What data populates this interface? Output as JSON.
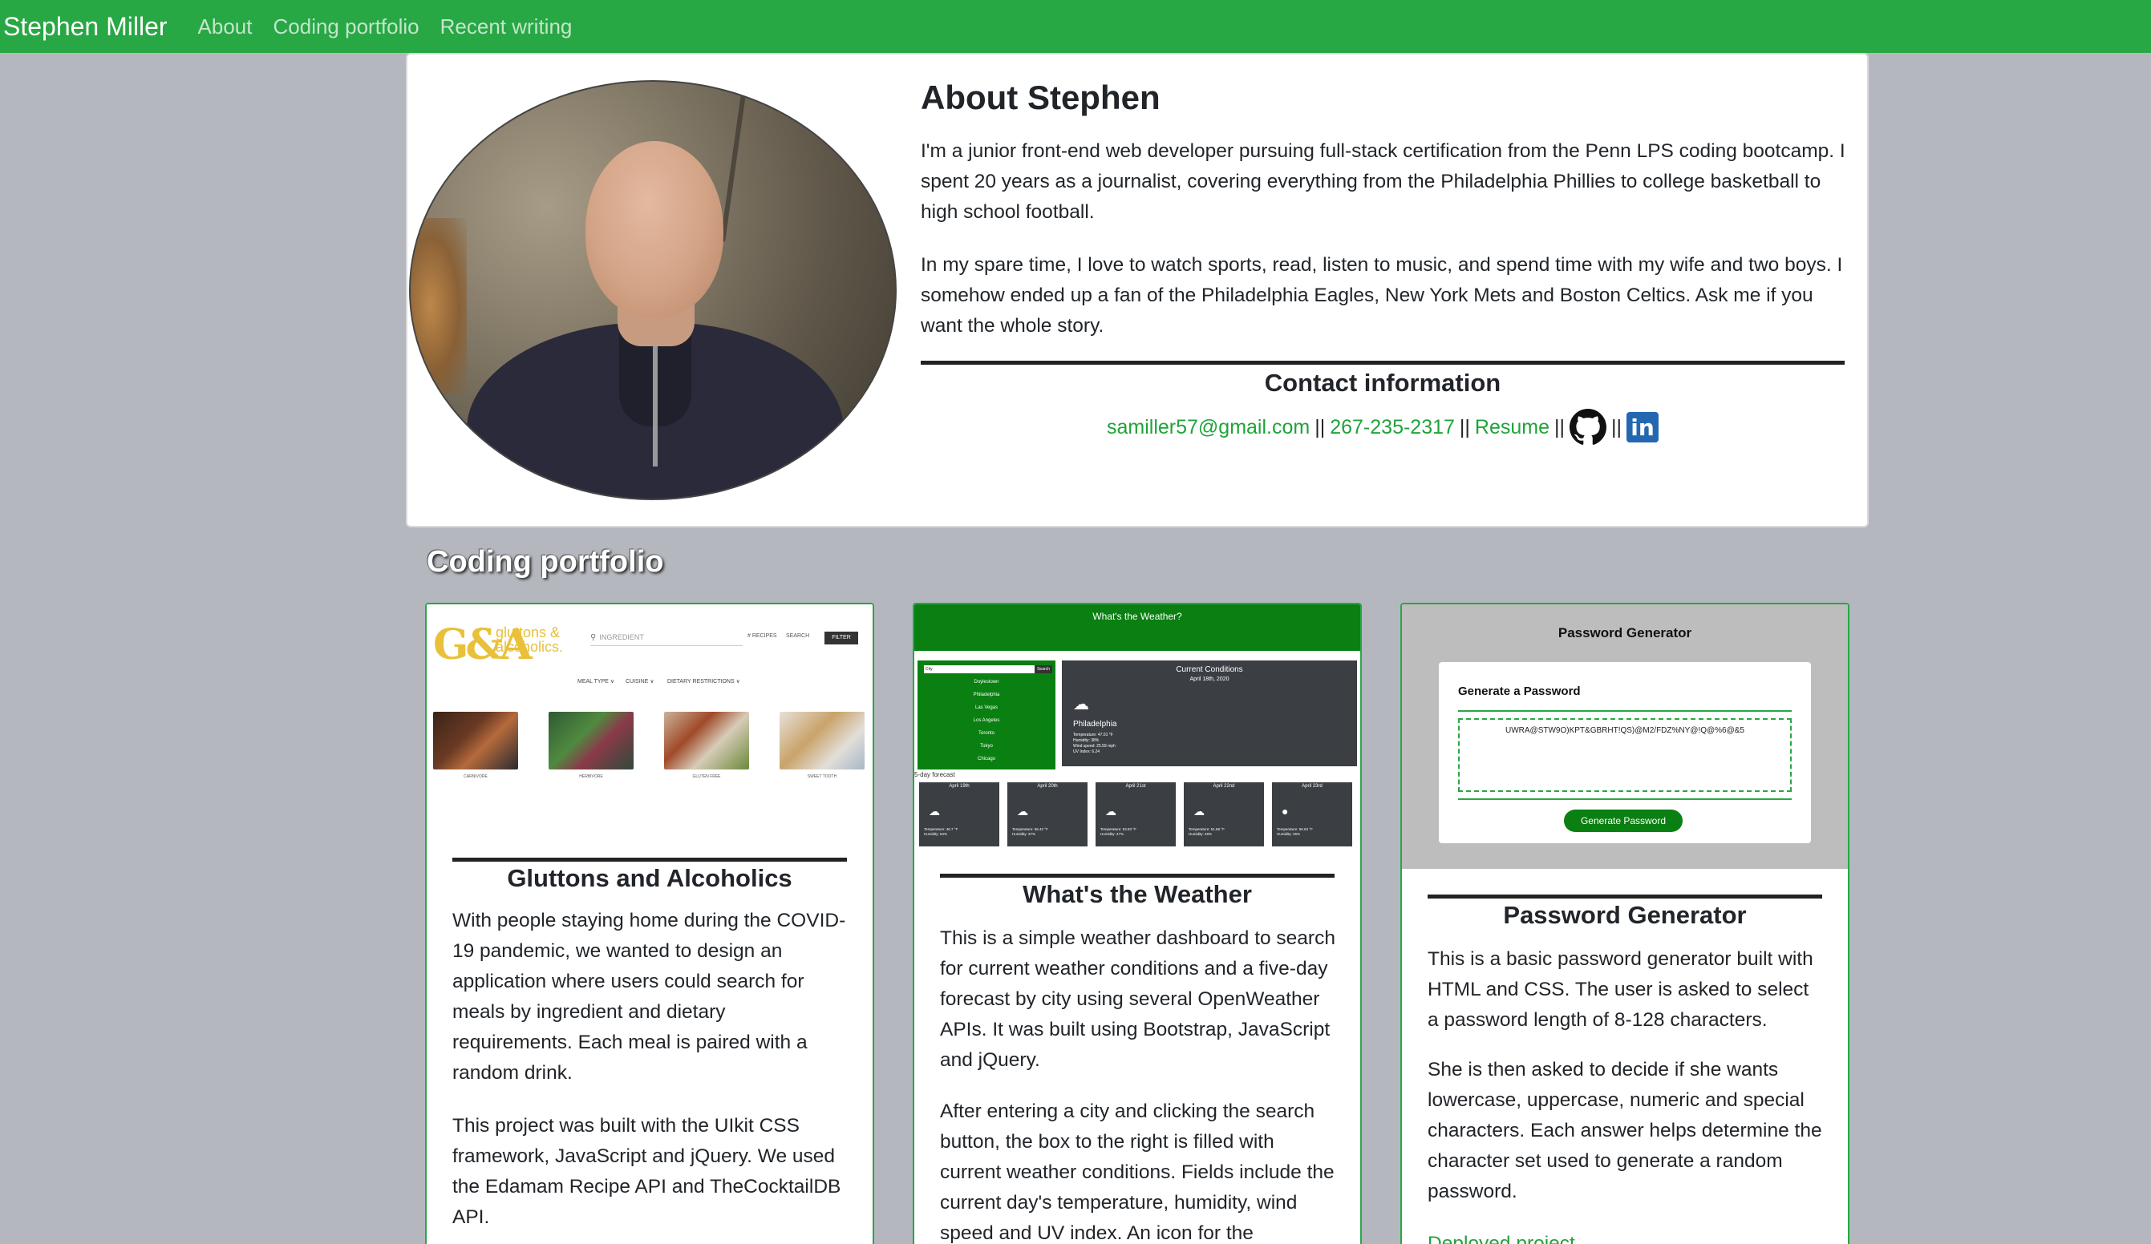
{
  "nav": {
    "brand": "Stephen Miller",
    "links": [
      "About",
      "Coding portfolio",
      "Recent writing"
    ]
  },
  "about": {
    "title": "About Stephen",
    "paragraphs": [
      "I'm a junior front-end web developer pursuing full-stack certification from the Penn LPS coding bootcamp. I spent 20 years as a journalist, covering everything from the Philadelphia Phillies to college basketball to high school football.",
      "In my spare time, I love to watch sports, read, listen to music, and spend time with my wife and two boys. I somehow ended up a fan of the Philadelphia Eagles, New York Mets and Boston Celtics. Ask me if you want the whole story."
    ],
    "contact_title": "Contact information",
    "email": "samiller57@gmail.com",
    "phone": "267-235-2317",
    "resume": "Resume",
    "separator": "||",
    "icons": [
      "github-icon",
      "linkedin-icon"
    ],
    "linkedin_glyph": "in"
  },
  "portfolio": {
    "heading": "Coding portfolio",
    "projects": [
      {
        "title": "Gluttons and Alcoholics",
        "paragraphs": [
          "With people staying home during the COVID-19 pandemic, we wanted to design an application where users could search for meals by ingredient and dietary requirements. Each meal is paired with a random drink.",
          "This project was built with the UIkit CSS framework, JavaScript and jQuery. We used the Edamam Recipe API and TheCocktailDB API."
        ],
        "screenshot": {
          "logo": "G&A",
          "logo_sub_1": "gluttons &",
          "logo_sub_2": "alcoholics.",
          "search_placeholder": "INGREDIENT",
          "recipes": "# RECIPES",
          "search": "SEARCH",
          "filter": "FILTER",
          "menu": [
            "MEAL TYPE ∨",
            "CUISINE ∨",
            "DIETARY RESTRICTIONS ∨"
          ],
          "captions": [
            "CARNIVORE",
            "HERBIVORE",
            "GLUTEN FREE",
            "SWEET TOOTH"
          ]
        }
      },
      {
        "title": "What's the Weather",
        "paragraphs": [
          "This is a simple weather dashboard to search for current weather conditions and a five-day forecast by city using several OpenWeather APIs. It was built using Bootstrap, JavaScript and jQuery.",
          "After entering a city and clicking the search button, the box to the right is filled with current weather conditions. Fields include the current day's temperature, humidity, wind speed and UV index. An icon for the"
        ],
        "screenshot": {
          "header": "What's the Weather?",
          "search_btn": "Search",
          "search_value": "City",
          "cities": [
            "Doylestown",
            "Philadelphia",
            "Las Vegas",
            "Los Angeles",
            "Toronto",
            "Tokyo",
            "Chicago"
          ],
          "current_title": "Current Conditions",
          "current_date": "April 18th, 2020",
          "current_city": "Philadelphia",
          "current_details": [
            "Temperature: 47.01 °F",
            "Humidity: 38%",
            "Wind speed: 25.59 mph",
            "UV Index: 6.24"
          ],
          "forecast_label": "5-day forecast",
          "days": [
            {
              "date": "April 19th",
              "temp": "Temperature: 46.7 °F",
              "hum": "Humidity: 64%"
            },
            {
              "date": "April 20th",
              "temp": "Temperature: 56.42 °F",
              "hum": "Humidity: 37%"
            },
            {
              "date": "April 21st",
              "temp": "Temperature: 53.83 °F",
              "hum": "Humidity: 47%"
            },
            {
              "date": "April 22nd",
              "temp": "Temperature: 51.68 °F",
              "hum": "Humidity: 49%"
            },
            {
              "date": "April 23rd",
              "temp": "Temperature: 56.63 °F",
              "hum": "Humidity: 45%"
            }
          ]
        }
      },
      {
        "title": "Password Generator",
        "paragraphs": [
          "This is a basic password generator built with HTML and CSS. The user is asked to select a password length of 8-128 characters.",
          "She is then asked to decide if she wants lowercase, uppercase, numeric and special characters. Each answer helps determine the character set used to generate a random password."
        ],
        "link": "Deployed project",
        "screenshot": {
          "title": "Password Generator",
          "panel_title": "Generate a Password",
          "password": "UWRA@STW9O)KPT&GBRHT!QS)@M2/FDZ%NY@!Q@%6@&5",
          "button": "Generate Password"
        }
      }
    ]
  },
  "colors": {
    "nav_green": "#28a745",
    "link_green": "#1fa33a",
    "page_bg": "#b4b8be",
    "linkedin_blue": "#2467b1"
  }
}
